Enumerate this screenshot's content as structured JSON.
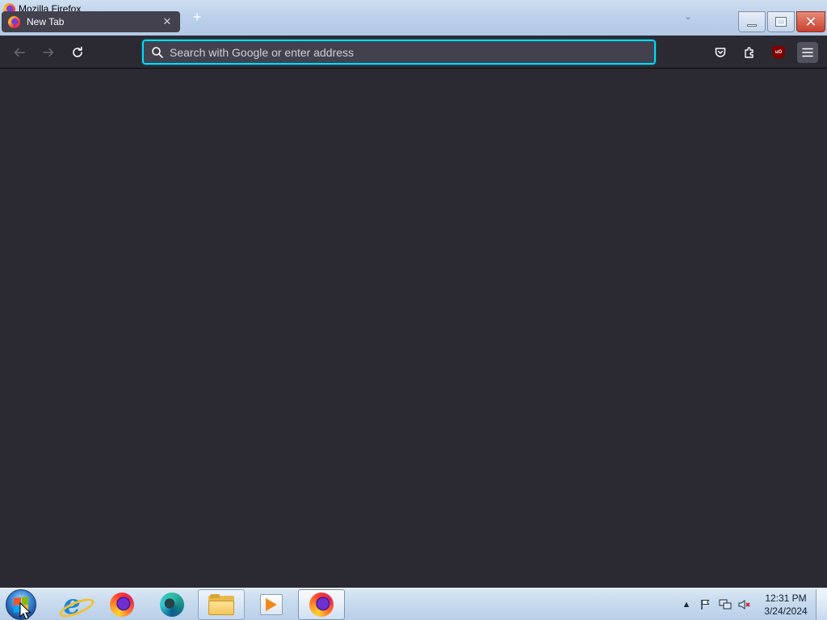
{
  "window": {
    "title": "Mozilla Firefox",
    "min_icon": "minimize-icon",
    "max_icon": "restore-icon",
    "close_icon": "close-icon"
  },
  "tabs": [
    {
      "label": "New Tab",
      "icon": "firefox-icon",
      "close_icon": "close-icon"
    }
  ],
  "tabstrip": {
    "new_tab_icon": "plus-icon",
    "list_tabs_icon": "chevron-down-icon"
  },
  "toolbar": {
    "back_icon": "arrow-left-icon",
    "forward_icon": "arrow-right-icon",
    "reload_icon": "reload-icon",
    "url_placeholder": "Search with Google or enter address",
    "url_value": "",
    "pocket_icon": "pocket-icon",
    "extensions_icon": "puzzle-icon",
    "ublock_icon": "ublock-origin-icon",
    "ublock_label": "uO",
    "menu_icon": "hamburger-icon"
  },
  "taskbar": {
    "start_icon": "windows-start-icon",
    "items": [
      {
        "name": "internet-explorer",
        "icon": "internet-explorer-icon",
        "state": "pinned"
      },
      {
        "name": "firefox",
        "icon": "firefox-icon",
        "state": "pinned"
      },
      {
        "name": "edge",
        "icon": "edge-icon",
        "state": "pinned"
      },
      {
        "name": "file-explorer",
        "icon": "folder-icon",
        "state": "open"
      },
      {
        "name": "media-player",
        "icon": "media-player-icon",
        "state": "pinned"
      },
      {
        "name": "firefox-window",
        "icon": "firefox-icon",
        "state": "active"
      }
    ],
    "tray": {
      "icons": [
        "show-hidden-icons-icon",
        "action-center-flag-icon",
        "network-icon",
        "volume-muted-icon"
      ],
      "time": "12:31 PM",
      "date": "3/24/2024"
    }
  },
  "colors": {
    "content_bg": "#2b2a33",
    "toolbar_bg": "#2b2a33",
    "urlbar_bg": "#42414d",
    "urlbar_focus": "#00ddff",
    "tab_bg": "#42414d"
  }
}
